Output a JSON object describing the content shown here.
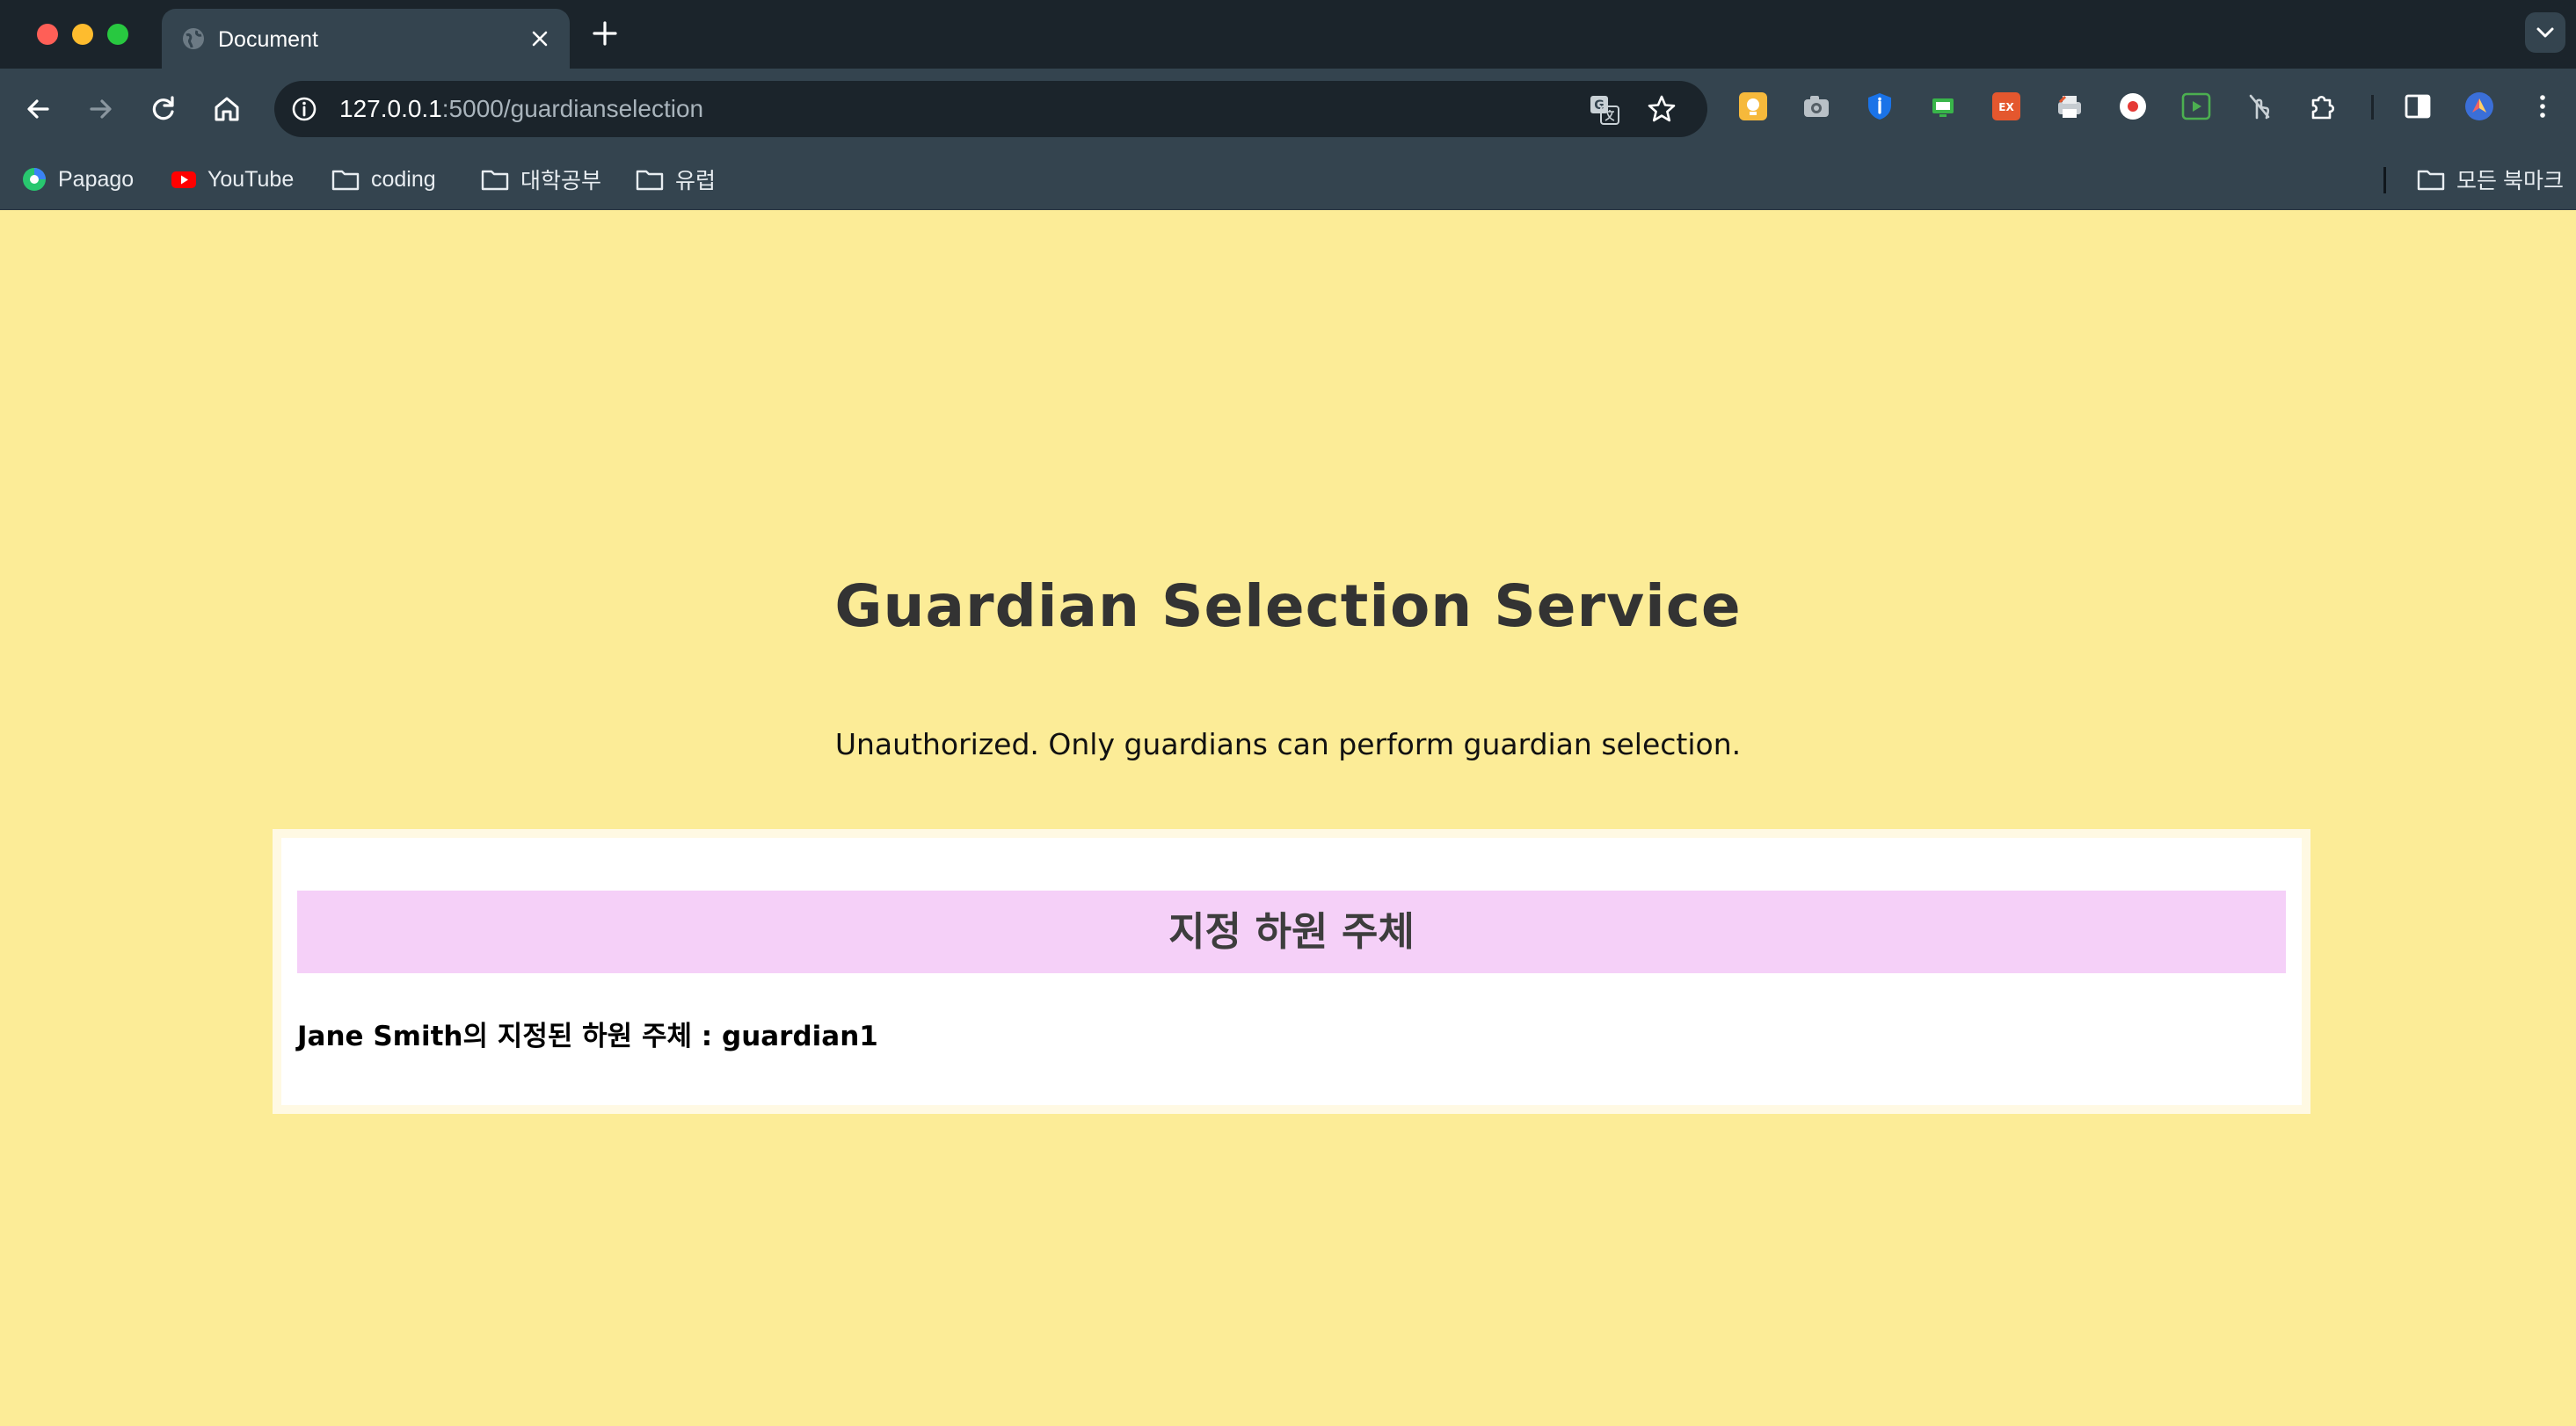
{
  "browser": {
    "tab": {
      "title": "Document"
    },
    "address": {
      "host": "127.0.0.1",
      "path": ":5000/guardianselection"
    },
    "extensions": [
      "keep-icon",
      "camera-icon",
      "shield-info-icon",
      "screen-icon",
      "ex-icon",
      "printer-icon",
      "record-icon",
      "play-icon",
      "touch-icon",
      "puzzle-icon",
      "sidebar-icon",
      "profile-icon",
      "menu-icon"
    ],
    "bookmarks": [
      {
        "label": "Papago",
        "icon": "papago-icon"
      },
      {
        "label": "YouTube",
        "icon": "youtube-icon"
      },
      {
        "label": "coding",
        "icon": "folder-icon"
      },
      {
        "label": "대학공부",
        "icon": "folder-icon"
      },
      {
        "label": "유럽",
        "icon": "folder-icon"
      }
    ],
    "all_bookmarks": {
      "label": "모든 북마크",
      "icon": "folder-icon"
    }
  },
  "page": {
    "title": "Guardian Selection Service",
    "message": "Unauthorized. Only guardians can perform guardian selection.",
    "card": {
      "header": "지정 하원 주체",
      "line": "Jane Smith의 지정된 하원 주체 : guardian1"
    }
  },
  "colors": {
    "page_background": "#fcec97",
    "card_header_background": "#f5d0f8",
    "tabstrip": "#1b242b",
    "toolbar": "#34444f"
  }
}
